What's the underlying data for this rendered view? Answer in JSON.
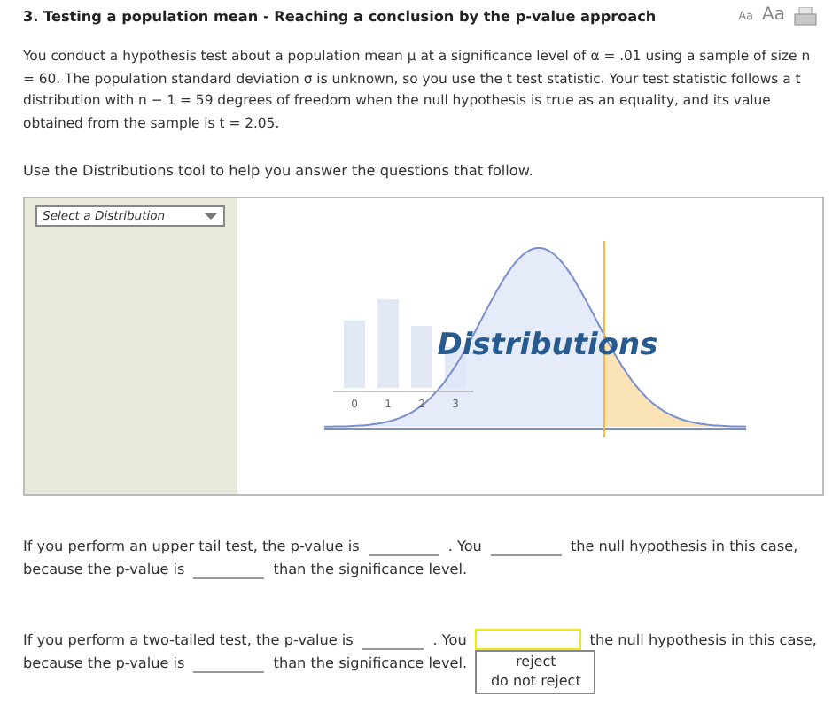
{
  "title": "3.  Testing a population mean - Reaching a conclusion by the p-value approach",
  "text_size_buttons": [
    {
      "label": "Aa"
    },
    {
      "label": "Aa"
    }
  ],
  "intro": "You conduct a hypothesis test about a population mean μ at a significance level of α = .01 using a sample of size n = 60. The population standard deviation σ is unknown, so you use the t test statistic. Your test statistic follows a t distribution with n − 1 = 59 degrees of freedom when the null hypothesis is true as an equality, and its value obtained from the sample is t = 2.05.",
  "instruction": "Use the Distributions tool to help you answer the questions that follow.",
  "tool": {
    "dropdown": {
      "placeholder": "Select a Distribution"
    },
    "logo_text": "Distributions",
    "axis_labels": [
      "0",
      "1",
      "2",
      "3"
    ]
  },
  "questions": [
    {
      "lines": [
        [
          {
            "kind": "text",
            "text": "If you perform an upper tail test, the p-value is"
          },
          {
            "kind": "blank"
          },
          {
            "kind": "text",
            "text": ". You"
          },
          {
            "kind": "blank"
          },
          {
            "kind": "text",
            "text": "the null hypothesis in this case,"
          }
        ],
        [
          {
            "kind": "text",
            "text": "because the p-value is"
          },
          {
            "kind": "blank"
          },
          {
            "kind": "text",
            "text": "than the significance level."
          }
        ]
      ]
    },
    {
      "lines": [
        [
          {
            "kind": "text",
            "text": "If you perform a two-tailed test, the p-value is"
          },
          {
            "kind": "blank"
          },
          {
            "kind": "text",
            "text": ". You"
          },
          {
            "kind": "dropdown",
            "expanded": true,
            "focused": true,
            "options": [
              "reject",
              "do not reject"
            ]
          },
          {
            "kind": "text",
            "text": "the null hypothesis in this case,"
          }
        ],
        [
          {
            "kind": "text",
            "text": "because the p-value is"
          },
          {
            "kind": "blank"
          },
          {
            "kind": "text",
            "text": "than the significance level."
          }
        ]
      ]
    }
  ]
}
